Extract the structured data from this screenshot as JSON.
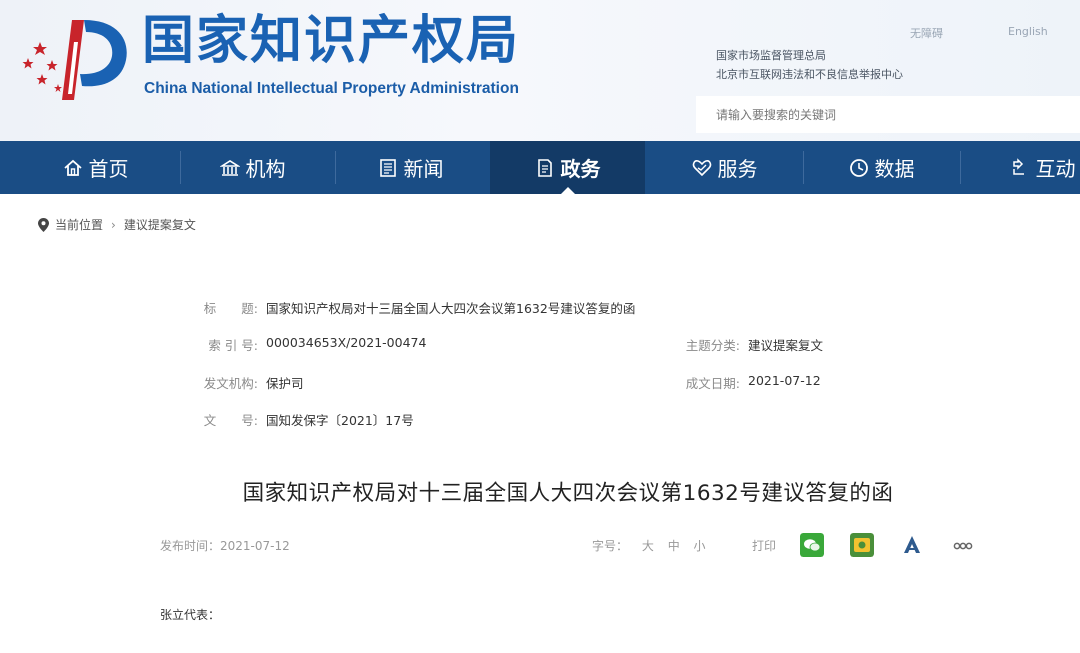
{
  "header": {
    "title": "国家知识产权局",
    "subtitle": "China National Intellectual Property Administration",
    "top_links": [
      "无障碍",
      "English"
    ],
    "notices": [
      "国家市场监督管理总局",
      "北京市互联网违法和不良信息举报中心"
    ],
    "search_placeholder": "请输入要搜索的关键词"
  },
  "nav": {
    "items": [
      {
        "label": "首页",
        "icon": "home-icon"
      },
      {
        "label": "机构",
        "icon": "building-icon"
      },
      {
        "label": "新闻",
        "icon": "news-icon"
      },
      {
        "label": "政务",
        "icon": "document-icon",
        "active": true
      },
      {
        "label": "服务",
        "icon": "heart-icon"
      },
      {
        "label": "数据",
        "icon": "clock-icon"
      },
      {
        "label": "互动",
        "icon": "chat-icon"
      }
    ]
  },
  "breadcrumb": {
    "items": [
      "当前位置",
      "建议提案复文"
    ],
    "separator": "›"
  },
  "meta": {
    "title_label": "标　　题:",
    "title_value": "国家知识产权局对十三届全国人大四次会议第1632号建议答复的函",
    "index_label": "索 引 号:",
    "index_value": "000034653X/2021-00474",
    "category_label": "主题分类:",
    "category_value": "建议提案复文",
    "issuer_label": "发文机构:",
    "issuer_value": "保护司",
    "date_label": "成文日期:",
    "date_value": "2021-07-12",
    "docno_label": "文　　号:",
    "docno_value": "国知发保字〔2021〕17号"
  },
  "article": {
    "title": "国家知识产权局对十三届全国人大四次会议第1632号建议答复的函",
    "date": "发布时间：2021-07-12",
    "font_size_label": "字号：",
    "font_sizes": [
      "大",
      "中",
      "小"
    ],
    "print_label": "打印",
    "share_icons": [
      "wechat-share-icon",
      "weibo-share-icon",
      "qq-share-icon",
      "more-share-icon"
    ],
    "salutation": "张立代表："
  },
  "colors": {
    "brand_blue": "#1a62b3",
    "nav_bg": "#1a4d85",
    "nav_active": "#133a66"
  }
}
